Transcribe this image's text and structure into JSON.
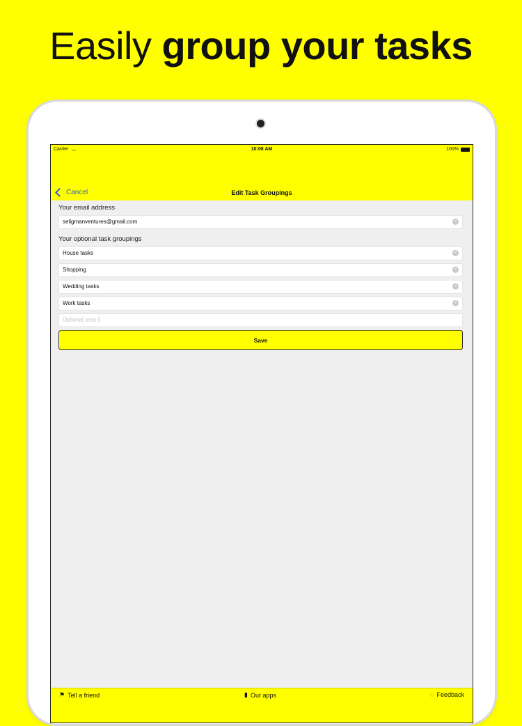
{
  "headline": {
    "light": "Easily ",
    "bold": "group your tasks"
  },
  "status_bar": {
    "carrier": "Carrier",
    "time": "10:08 AM",
    "battery": "100%"
  },
  "nav": {
    "back_label": "Cancel",
    "title": "Edit Task Groupings"
  },
  "email_section": {
    "label": "Your email address",
    "value": "seligmanventures@gmail.com"
  },
  "groupings_section": {
    "label": "Your optional task groupings",
    "fields": [
      "House tasks",
      "Shopping",
      "Wedding tasks",
      "Work tasks"
    ],
    "empty_placeholder": "Optional area 5"
  },
  "save_label": "Save",
  "tabbar": {
    "tell_friend": "Tell a friend",
    "our_apps": "Our apps",
    "feedback": "Feedback"
  },
  "colors": {
    "accent": "#FFFF00",
    "link": "#2a5bd7",
    "screen_bg": "#efefef"
  },
  "icons": {
    "back": "chevron-left-icon",
    "clear": "clear-circle-icon",
    "tell_friend": "flag-icon",
    "our_apps": "phone-icon",
    "feedback": "speech-bubble-icon"
  }
}
